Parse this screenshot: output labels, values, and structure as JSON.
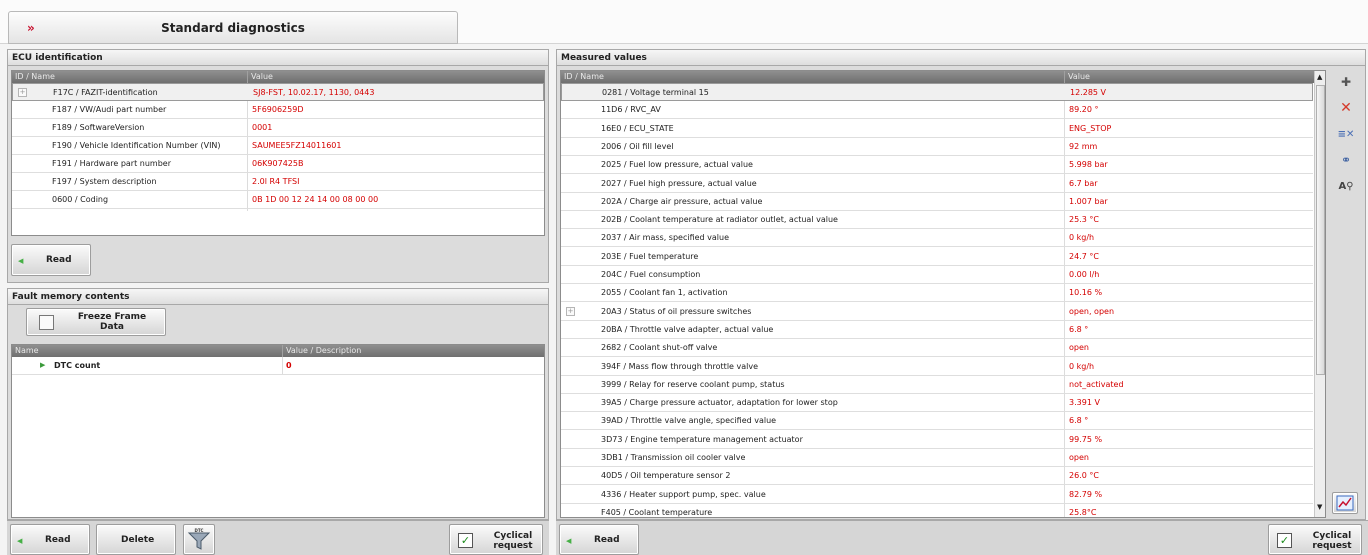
{
  "header": {
    "arrows": "»",
    "title": "Standard diagnostics"
  },
  "ecu": {
    "title": "ECU identification",
    "columns": [
      "ID / Name",
      "Value"
    ],
    "rows": [
      {
        "name": "F17C / FAZIT-identification",
        "value": "SJ8-FST, 10.02.17, 1130, 0443"
      },
      {
        "name": "F187 / VW/Audi part number",
        "value": "5F6906259D"
      },
      {
        "name": "F189 / SoftwareVersion",
        "value": "0001"
      },
      {
        "name": "F190 / Vehicle Identification Number (VIN)",
        "value": "SAUMEE5FZ14011601"
      },
      {
        "name": "F191 / Hardware part number",
        "value": "06K907425B"
      },
      {
        "name": "F197 / System description",
        "value": "2.0l R4 TFSI"
      },
      {
        "name": "0600 / Coding",
        "value": "0B 1D 00 12 24 14 00 08 00 00"
      }
    ],
    "read_label": "Read"
  },
  "fault": {
    "title": "Fault memory contents",
    "freeze_label_line1": "Freeze Frame",
    "freeze_label_line2": "Data",
    "columns": [
      "Name",
      "Value / Description"
    ],
    "rows": [
      {
        "name": "DTC count",
        "value": "0"
      }
    ],
    "read_label": "Read",
    "delete_label": "Delete",
    "filter_badge": "DTC",
    "cyclical_line1": "Cyclical",
    "cyclical_line2": "request"
  },
  "measured": {
    "title": "Measured values",
    "columns": [
      "ID / Name",
      "Value"
    ],
    "rows": [
      {
        "name": "0281 / Voltage terminal 15",
        "value": "12.285 V"
      },
      {
        "name": "11D6 / RVC_AV",
        "value": "89.20 °"
      },
      {
        "name": "16E0 / ECU_STATE",
        "value": "ENG_STOP"
      },
      {
        "name": "2006 / Oil fill level",
        "value": "92 mm"
      },
      {
        "name": "2025 / Fuel low pressure, actual value",
        "value": "5.998 bar"
      },
      {
        "name": "2027 / Fuel high pressure, actual value",
        "value": "6.7 bar"
      },
      {
        "name": "202A / Charge air pressure, actual value",
        "value": "1.007 bar"
      },
      {
        "name": "202B / Coolant temperature at radiator outlet, actual value",
        "value": "25.3 °C"
      },
      {
        "name": "2037 / Air mass, specified value",
        "value": "0 kg/h"
      },
      {
        "name": "203E / Fuel temperature",
        "value": "24.7 °C"
      },
      {
        "name": "204C / Fuel consumption",
        "value": "0.00 l/h"
      },
      {
        "name": "2055 / Coolant fan 1, activation",
        "value": "10.16 %"
      },
      {
        "name": "20A3 / Status of oil pressure switches",
        "value": "open, open"
      },
      {
        "name": "20BA / Throttle valve adapter, actual value",
        "value": "6.8 °"
      },
      {
        "name": "2682 / Coolant shut-off valve",
        "value": "open"
      },
      {
        "name": "394F / Mass flow through throttle valve",
        "value": "0 kg/h"
      },
      {
        "name": "3999 / Relay for reserve coolant pump, status",
        "value": "not_activated"
      },
      {
        "name": "39A5 / Charge pressure actuator, adaptation for lower stop",
        "value": "3.391 V"
      },
      {
        "name": "39AD / Throttle valve angle, specified value",
        "value": "6.8 °"
      },
      {
        "name": "3D73 / Engine temperature management actuator",
        "value": "99.75 %"
      },
      {
        "name": "3DB1 / Transmission oil cooler valve",
        "value": "open"
      },
      {
        "name": "40D5 / Oil temperature sensor 2",
        "value": "26.0 °C"
      },
      {
        "name": "4336 / Heater support pump, spec. value",
        "value": "82.79 %"
      },
      {
        "name": "F405 / Coolant temperature",
        "value": "25.8°C"
      }
    ],
    "read_label": "Read",
    "cyclical_line1": "Cyclical",
    "cyclical_line2": "request"
  },
  "colors": {
    "value_red": "#d40000",
    "check_green": "#1c8c1c"
  }
}
